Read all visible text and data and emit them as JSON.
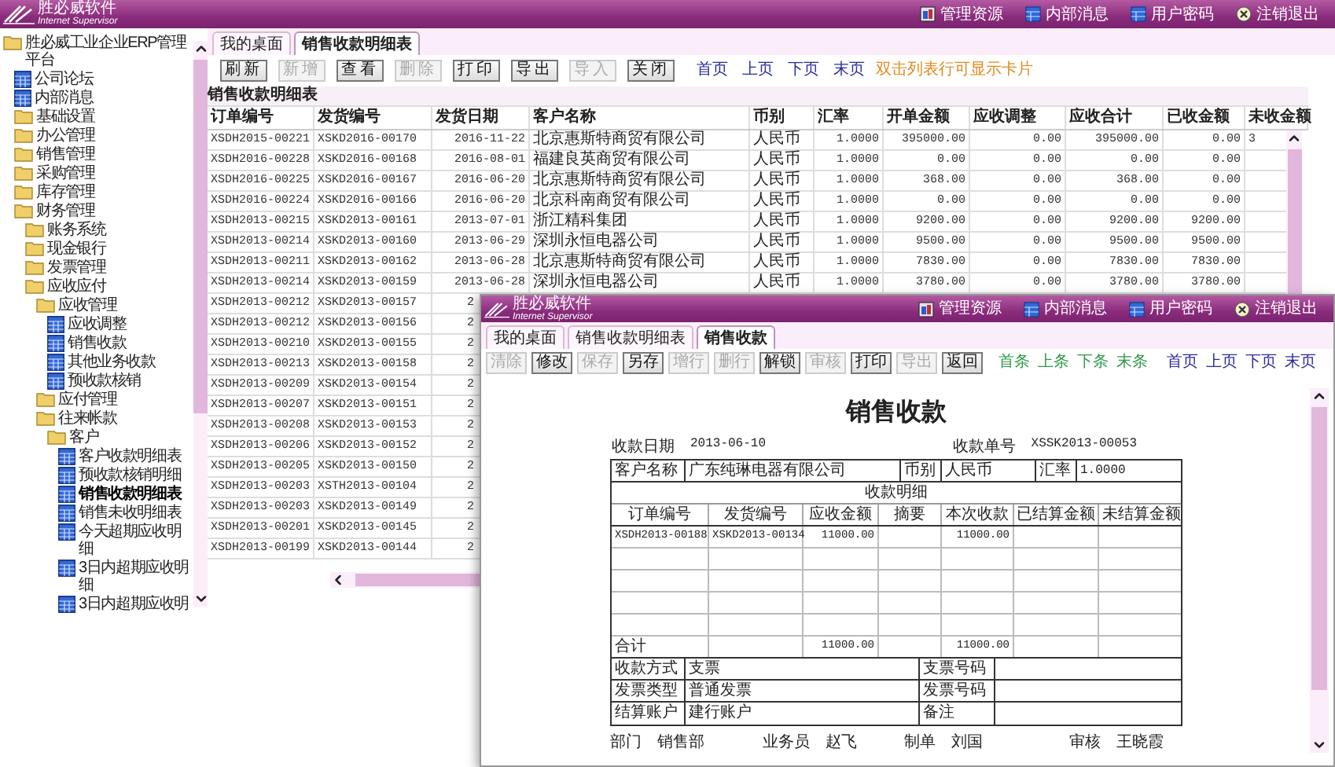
{
  "app": {
    "logo": {
      "name": "胜必威软件",
      "tagline": "Internet Supervisor"
    },
    "menu": [
      {
        "label": "管理资源"
      },
      {
        "label": "内部消息"
      },
      {
        "label": "用户密码"
      },
      {
        "label": "注销退出"
      }
    ]
  },
  "sidebar": {
    "tree": [
      {
        "label": "胜必威工业企业ERP管理平台",
        "kind": "folder",
        "selected": false,
        "children": [
          {
            "label": "公司论坛",
            "kind": "report",
            "selected": false
          },
          {
            "label": "内部消息",
            "kind": "report",
            "selected": false
          },
          {
            "label": "基础设置",
            "kind": "folder",
            "selected": false
          },
          {
            "label": "办公管理",
            "kind": "folder",
            "selected": false
          },
          {
            "label": "销售管理",
            "kind": "folder",
            "selected": false
          },
          {
            "label": "采购管理",
            "kind": "folder",
            "selected": false
          },
          {
            "label": "库存管理",
            "kind": "folder",
            "selected": false
          },
          {
            "label": "财务管理",
            "kind": "folder",
            "selected": false,
            "children": [
              {
                "label": "账务系统",
                "kind": "folder",
                "selected": false
              },
              {
                "label": "现金银行",
                "kind": "folder",
                "selected": false
              },
              {
                "label": "发票管理",
                "kind": "folder",
                "selected": false
              },
              {
                "label": "应收应付",
                "kind": "folder",
                "selected": false,
                "children": [
                  {
                    "label": "应收管理",
                    "kind": "folder",
                    "selected": false,
                    "children": [
                      {
                        "label": "应收调整",
                        "kind": "report",
                        "selected": false
                      },
                      {
                        "label": "销售收款",
                        "kind": "report",
                        "selected": false
                      },
                      {
                        "label": "其他业务收款",
                        "kind": "report",
                        "selected": false
                      },
                      {
                        "label": "预收款核销",
                        "kind": "report",
                        "selected": false
                      }
                    ]
                  },
                  {
                    "label": "应付管理",
                    "kind": "folder",
                    "selected": false
                  },
                  {
                    "label": "往来帐款",
                    "kind": "folder",
                    "selected": false,
                    "children": [
                      {
                        "label": "客户",
                        "kind": "folder",
                        "selected": false,
                        "children": [
                          {
                            "label": "客户收款明细表",
                            "kind": "report",
                            "selected": false
                          },
                          {
                            "label": "预收款核销明细",
                            "kind": "report",
                            "selected": false
                          },
                          {
                            "label": "销售收款明细表",
                            "kind": "report",
                            "selected": true
                          },
                          {
                            "label": "销售未收明细表",
                            "kind": "report",
                            "selected": false
                          },
                          {
                            "label": "今天超期应收明细",
                            "kind": "report",
                            "selected": false
                          },
                          {
                            "label": "3日内超期应收明细",
                            "kind": "report",
                            "selected": false
                          },
                          {
                            "label": "3日内超期应收明",
                            "kind": "report",
                            "selected": false
                          }
                        ]
                      }
                    ]
                  }
                ]
              }
            ]
          }
        ]
      }
    ]
  },
  "tabs": [
    {
      "label": "我的桌面",
      "selected": false
    },
    {
      "label": "销售收款明细表",
      "selected": true
    }
  ],
  "toolbar": {
    "buttons": [
      {
        "label": "刷新",
        "disabled": false
      },
      {
        "label": "新增",
        "disabled": true
      },
      {
        "label": "查看",
        "disabled": false
      },
      {
        "label": "删除",
        "disabled": true
      },
      {
        "label": "打印",
        "disabled": false
      },
      {
        "label": "导出",
        "disabled": false
      },
      {
        "label": "导入",
        "disabled": true
      },
      {
        "label": "关闭",
        "disabled": false
      }
    ],
    "pager": [
      "首页",
      "上页",
      "下页",
      "末页"
    ],
    "hint": "双击列表行可显示卡片"
  },
  "table": {
    "title": "销售收款明细表",
    "columns": [
      "订单编号",
      "发货编号",
      "发货日期",
      "客户名称",
      "币别",
      "汇率",
      "开单金额",
      "应收调整",
      "应收合计",
      "已收金额",
      "未收金额"
    ],
    "rows": [
      {
        "cells": [
          "XSDH2015-00221",
          "XSKD2016-00170",
          "2016-11-22",
          "北京惠斯特商贸有限公司",
          "人民币",
          "1.0000",
          "395000.00",
          "0.00",
          "395000.00",
          "0.00",
          "3"
        ]
      },
      {
        "cells": [
          "XSDH2016-00228",
          "XSKD2016-00168",
          "2016-08-01",
          "福建良英商贸有限公司",
          "人民币",
          "1.0000",
          "0.00",
          "0.00",
          "0.00",
          "0.00"
        ]
      },
      {
        "cells": [
          "XSDH2016-00225",
          "XSKD2016-00167",
          "2016-06-20",
          "北京惠斯特商贸有限公司",
          "人民币",
          "1.0000",
          "368.00",
          "0.00",
          "368.00",
          "0.00"
        ]
      },
      {
        "cells": [
          "XSDH2016-00224",
          "XSKD2016-00166",
          "2016-06-20",
          "北京科南商贸有限公司",
          "人民币",
          "1.0000",
          "0.00",
          "0.00",
          "0.00",
          "0.00"
        ]
      },
      {
        "cells": [
          "XSDH2013-00215",
          "XSKD2013-00161",
          "2013-07-01",
          "浙江精科集团",
          "人民币",
          "1.0000",
          "9200.00",
          "0.00",
          "9200.00",
          "9200.00"
        ]
      },
      {
        "cells": [
          "XSDH2013-00214",
          "XSKD2013-00160",
          "2013-06-29",
          "深圳永恒电器公司",
          "人民币",
          "1.0000",
          "9500.00",
          "0.00",
          "9500.00",
          "9500.00"
        ]
      },
      {
        "cells": [
          "XSDH2013-00211",
          "XSKD2013-00162",
          "2013-06-28",
          "北京惠斯特商贸有限公司",
          "人民币",
          "1.0000",
          "7830.00",
          "0.00",
          "7830.00",
          "7830.00"
        ]
      },
      {
        "cells": [
          "XSDH2013-00214",
          "XSKD2013-00159",
          "2013-06-28",
          "深圳永恒电器公司",
          "人民币",
          "1.0000",
          "3780.00",
          "0.00",
          "3780.00",
          "3780.00"
        ]
      },
      {
        "cells": [
          "XSDH2013-00212",
          "XSKD2013-00157",
          "2"
        ]
      },
      {
        "cells": [
          "XSDH2013-00212",
          "XSKD2013-00156",
          "2"
        ]
      },
      {
        "cells": [
          "XSDH2013-00210",
          "XSKD2013-00155",
          "2"
        ]
      },
      {
        "cells": [
          "XSDH2013-00213",
          "XSKD2013-00158",
          "2"
        ]
      },
      {
        "cells": [
          "XSDH2013-00209",
          "XSKD2013-00154",
          "2"
        ]
      },
      {
        "cells": [
          "XSDH2013-00207",
          "XSKD2013-00151",
          "2"
        ]
      },
      {
        "cells": [
          "XSDH2013-00208",
          "XSKD2013-00153",
          "2"
        ]
      },
      {
        "cells": [
          "XSDH2013-00206",
          "XSKD2013-00152",
          "2"
        ]
      },
      {
        "cells": [
          "XSDH2013-00205",
          "XSKD2013-00150",
          "2"
        ]
      },
      {
        "cells": [
          "XSDH2013-00203",
          "XSTH2013-00104",
          "2"
        ]
      },
      {
        "cells": [
          "XSDH2013-00203",
          "XSKD2013-00149",
          "2"
        ]
      },
      {
        "cells": [
          "XSDH2013-00201",
          "XSKD2013-00145",
          "2"
        ]
      },
      {
        "cells": [
          "XSDH2013-00199",
          "XSKD2013-00144",
          "2"
        ]
      }
    ]
  },
  "dialog": {
    "logo": {
      "name": "胜必威软件",
      "tagline": "Internet Supervisor"
    },
    "menu": [
      {
        "label": "管理资源"
      },
      {
        "label": "内部消息"
      },
      {
        "label": "用户密码"
      },
      {
        "label": "注销退出"
      }
    ],
    "tabs": [
      {
        "label": "我的桌面",
        "selected": false
      },
      {
        "label": "销售收款明细表",
        "selected": false
      },
      {
        "label": "销售收款",
        "selected": true
      }
    ],
    "buttons": [
      {
        "label": "清除",
        "disabled": true
      },
      {
        "label": "修改",
        "disabled": false
      },
      {
        "label": "保存",
        "disabled": true
      },
      {
        "label": "另存",
        "disabled": false
      },
      {
        "label": "增行",
        "disabled": true
      },
      {
        "label": "删行",
        "disabled": true
      },
      {
        "label": "解锁",
        "disabled": false
      },
      {
        "label": "审核",
        "disabled": true
      },
      {
        "label": "打印",
        "disabled": false
      },
      {
        "label": "导出",
        "disabled": true
      },
      {
        "label": "返回",
        "disabled": false
      }
    ],
    "record_nav": [
      "首条",
      "上条",
      "下条",
      "末条"
    ],
    "pager": [
      "首页",
      "上页",
      "下页",
      "末页"
    ],
    "form": {
      "title": "销售收款",
      "date": {
        "label": "收款日期",
        "value": "2013-06-10"
      },
      "number": {
        "label": "收款单号",
        "value": "XSSK2013-00053"
      },
      "header": [
        {
          "label": "客户名称",
          "value": "广东纯琳电器有限公司"
        },
        {
          "label": "币别",
          "value": "人民币"
        },
        {
          "label": "汇率",
          "value": "1.0000"
        }
      ],
      "detail": {
        "title": "收款明细",
        "columns": [
          "订单编号",
          "发货编号",
          "应收金额",
          "摘要",
          "本次收款",
          "已结算金额",
          "未结算金额"
        ],
        "rows": [
          {
            "order": "XSDH2013-00188",
            "shipment": "XSKD2013-00134",
            "receivable": "11000.00",
            "received": "11000.00"
          }
        ],
        "total": {
          "label": "合计",
          "receivable": "11000.00",
          "received": "11000.00"
        }
      },
      "info": [
        {
          "label": "收款方式",
          "value": "支票",
          "label2": "支票号码"
        },
        {
          "label": "发票类型",
          "value": "普通发票",
          "label2": "发票号码"
        },
        {
          "label": "结算账户",
          "value": "建行账户",
          "label2": "备注"
        }
      ],
      "signatures": [
        {
          "label": "部门",
          "value": "销售部"
        },
        {
          "label": "业务员",
          "value": "赵飞"
        },
        {
          "label": "制单",
          "value": "刘国"
        },
        {
          "label": "审核",
          "value": "王晓霞"
        }
      ]
    }
  }
}
